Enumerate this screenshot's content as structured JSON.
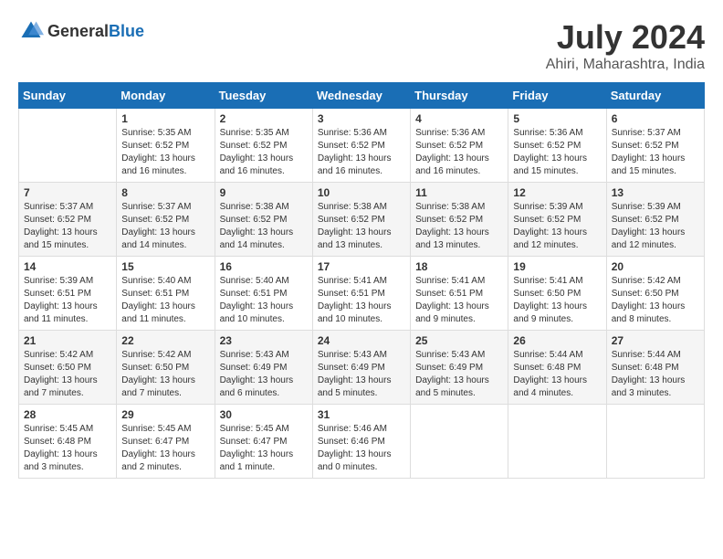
{
  "header": {
    "logo_general": "General",
    "logo_blue": "Blue",
    "month_year": "July 2024",
    "location": "Ahiri, Maharashtra, India"
  },
  "days_of_week": [
    "Sunday",
    "Monday",
    "Tuesday",
    "Wednesday",
    "Thursday",
    "Friday",
    "Saturday"
  ],
  "weeks": [
    [
      {
        "day": "",
        "content": ""
      },
      {
        "day": "1",
        "content": "Sunrise: 5:35 AM\nSunset: 6:52 PM\nDaylight: 13 hours\nand 16 minutes."
      },
      {
        "day": "2",
        "content": "Sunrise: 5:35 AM\nSunset: 6:52 PM\nDaylight: 13 hours\nand 16 minutes."
      },
      {
        "day": "3",
        "content": "Sunrise: 5:36 AM\nSunset: 6:52 PM\nDaylight: 13 hours\nand 16 minutes."
      },
      {
        "day": "4",
        "content": "Sunrise: 5:36 AM\nSunset: 6:52 PM\nDaylight: 13 hours\nand 16 minutes."
      },
      {
        "day": "5",
        "content": "Sunrise: 5:36 AM\nSunset: 6:52 PM\nDaylight: 13 hours\nand 15 minutes."
      },
      {
        "day": "6",
        "content": "Sunrise: 5:37 AM\nSunset: 6:52 PM\nDaylight: 13 hours\nand 15 minutes."
      }
    ],
    [
      {
        "day": "7",
        "content": "Sunrise: 5:37 AM\nSunset: 6:52 PM\nDaylight: 13 hours\nand 15 minutes."
      },
      {
        "day": "8",
        "content": "Sunrise: 5:37 AM\nSunset: 6:52 PM\nDaylight: 13 hours\nand 14 minutes."
      },
      {
        "day": "9",
        "content": "Sunrise: 5:38 AM\nSunset: 6:52 PM\nDaylight: 13 hours\nand 14 minutes."
      },
      {
        "day": "10",
        "content": "Sunrise: 5:38 AM\nSunset: 6:52 PM\nDaylight: 13 hours\nand 13 minutes."
      },
      {
        "day": "11",
        "content": "Sunrise: 5:38 AM\nSunset: 6:52 PM\nDaylight: 13 hours\nand 13 minutes."
      },
      {
        "day": "12",
        "content": "Sunrise: 5:39 AM\nSunset: 6:52 PM\nDaylight: 13 hours\nand 12 minutes."
      },
      {
        "day": "13",
        "content": "Sunrise: 5:39 AM\nSunset: 6:52 PM\nDaylight: 13 hours\nand 12 minutes."
      }
    ],
    [
      {
        "day": "14",
        "content": "Sunrise: 5:39 AM\nSunset: 6:51 PM\nDaylight: 13 hours\nand 11 minutes."
      },
      {
        "day": "15",
        "content": "Sunrise: 5:40 AM\nSunset: 6:51 PM\nDaylight: 13 hours\nand 11 minutes."
      },
      {
        "day": "16",
        "content": "Sunrise: 5:40 AM\nSunset: 6:51 PM\nDaylight: 13 hours\nand 10 minutes."
      },
      {
        "day": "17",
        "content": "Sunrise: 5:41 AM\nSunset: 6:51 PM\nDaylight: 13 hours\nand 10 minutes."
      },
      {
        "day": "18",
        "content": "Sunrise: 5:41 AM\nSunset: 6:51 PM\nDaylight: 13 hours\nand 9 minutes."
      },
      {
        "day": "19",
        "content": "Sunrise: 5:41 AM\nSunset: 6:50 PM\nDaylight: 13 hours\nand 9 minutes."
      },
      {
        "day": "20",
        "content": "Sunrise: 5:42 AM\nSunset: 6:50 PM\nDaylight: 13 hours\nand 8 minutes."
      }
    ],
    [
      {
        "day": "21",
        "content": "Sunrise: 5:42 AM\nSunset: 6:50 PM\nDaylight: 13 hours\nand 7 minutes."
      },
      {
        "day": "22",
        "content": "Sunrise: 5:42 AM\nSunset: 6:50 PM\nDaylight: 13 hours\nand 7 minutes."
      },
      {
        "day": "23",
        "content": "Sunrise: 5:43 AM\nSunset: 6:49 PM\nDaylight: 13 hours\nand 6 minutes."
      },
      {
        "day": "24",
        "content": "Sunrise: 5:43 AM\nSunset: 6:49 PM\nDaylight: 13 hours\nand 5 minutes."
      },
      {
        "day": "25",
        "content": "Sunrise: 5:43 AM\nSunset: 6:49 PM\nDaylight: 13 hours\nand 5 minutes."
      },
      {
        "day": "26",
        "content": "Sunrise: 5:44 AM\nSunset: 6:48 PM\nDaylight: 13 hours\nand 4 minutes."
      },
      {
        "day": "27",
        "content": "Sunrise: 5:44 AM\nSunset: 6:48 PM\nDaylight: 13 hours\nand 3 minutes."
      }
    ],
    [
      {
        "day": "28",
        "content": "Sunrise: 5:45 AM\nSunset: 6:48 PM\nDaylight: 13 hours\nand 3 minutes."
      },
      {
        "day": "29",
        "content": "Sunrise: 5:45 AM\nSunset: 6:47 PM\nDaylight: 13 hours\nand 2 minutes."
      },
      {
        "day": "30",
        "content": "Sunrise: 5:45 AM\nSunset: 6:47 PM\nDaylight: 13 hours\nand 1 minute."
      },
      {
        "day": "31",
        "content": "Sunrise: 5:46 AM\nSunset: 6:46 PM\nDaylight: 13 hours\nand 0 minutes."
      },
      {
        "day": "",
        "content": ""
      },
      {
        "day": "",
        "content": ""
      },
      {
        "day": "",
        "content": ""
      }
    ]
  ]
}
